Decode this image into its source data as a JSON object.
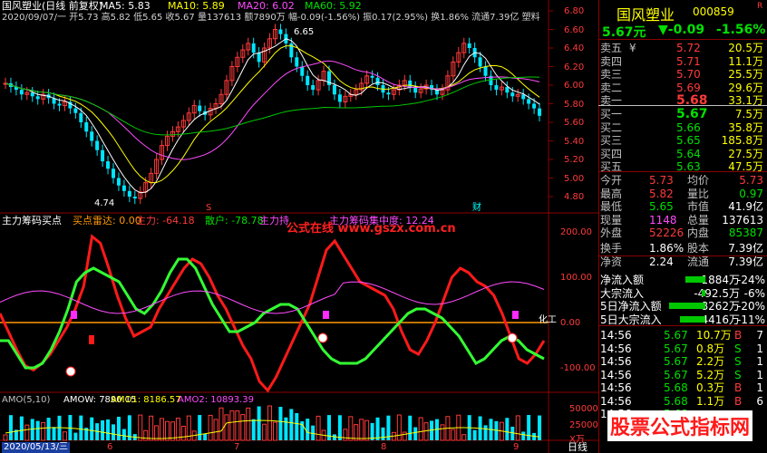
{
  "main_chart": {
    "title": "国风塑业(日线 前复权)",
    "ma5": "MA5: 5.83",
    "ma10": "MA10: 5.89",
    "ma20": "MA20: 6.02",
    "ma60": "MA60: 5.92",
    "ohlc_line": "2020/09/07/一 开5.73 高5.82 低5.65 收5.67 量137613 额7890万 幅-0.09(-1.56%) 振0.17(2.95%) 换1.86% 流通7.39亿 塑料",
    "high_mark": "6.65",
    "low_mark": "4.74",
    "price_axis": [
      "6.80",
      "6.60",
      "6.40",
      "6.20",
      "6.00",
      "5.80",
      "5.60",
      "5.40",
      "5.20",
      "5.00",
      "4.80"
    ],
    "marker_s": "S",
    "marker_cai": "财"
  },
  "indicator_chart": {
    "title": "主力筹码买点",
    "buy_radar": "买点雷达: 0.00",
    "main_force": "主力: -64.18",
    "retail": "散户: -78.78",
    "main_hold": "主力持",
    "concentration": "主力筹码集中度: 12.24",
    "sector_label": "化工",
    "axis": [
      "200.00",
      "100.00",
      "0.00",
      "-100.00"
    ],
    "watermark": "公式在线 www.gszx.com.cn"
  },
  "volume_chart": {
    "title": "AMO(5,10)",
    "amow": "AMOW: 7890.15",
    "amo1": "AMO1: 8186.57",
    "amo2": "AMO2: 10893.39",
    "axis": [
      "50000",
      "25000",
      "X万"
    ],
    "date_label": "2020/05/13/三",
    "month_labels": [
      "6",
      "7",
      "8",
      "9"
    ],
    "tab_label": "日线",
    "watermark": "股票公式指标网"
  },
  "quote_panel": {
    "stock_name": "国风塑业",
    "stock_code": "000859",
    "r_badge": "R",
    "price": "5.67元",
    "change": "▼-0.09",
    "change_pct": "-1.56%",
    "asks": [
      {
        "label": "卖五",
        "mark": "¥",
        "price": "5.72",
        "vol": "20.5万"
      },
      {
        "label": "卖四",
        "mark": "",
        "price": "5.71",
        "vol": "11.1万"
      },
      {
        "label": "卖三",
        "mark": "",
        "price": "5.70",
        "vol": "25.5万"
      },
      {
        "label": "卖二",
        "mark": "",
        "price": "5.69",
        "vol": "29.6万"
      },
      {
        "label": "卖一",
        "mark": "",
        "price": "5.68",
        "vol": "33.1万"
      }
    ],
    "bids": [
      {
        "label": "买一",
        "price": "5.67",
        "vol": "7.5万"
      },
      {
        "label": "买二",
        "price": "5.66",
        "vol": "35.8万"
      },
      {
        "label": "买三",
        "price": "5.65",
        "vol": "185.8万"
      },
      {
        "label": "买四",
        "price": "5.64",
        "vol": "27.5万"
      },
      {
        "label": "买五",
        "price": "5.63",
        "vol": "47.5万"
      }
    ],
    "stats": [
      {
        "l1": "今开",
        "v1": "5.73",
        "c1": "red",
        "l2": "均价",
        "v2": "5.73",
        "c2": "red"
      },
      {
        "l1": "最高",
        "v1": "5.82",
        "c1": "red",
        "l2": "量比",
        "v2": "0.97",
        "c2": "green"
      },
      {
        "l1": "最低",
        "v1": "5.65",
        "c1": "green",
        "l2": "市值",
        "v2": "41.9亿",
        "c2": "white"
      },
      {
        "l1": "现量",
        "v1": "1148",
        "c1": "mag",
        "l2": "总量",
        "v2": "137613",
        "c2": "white"
      },
      {
        "l1": "外盘",
        "v1": "52226",
        "c1": "red",
        "l2": "内盘",
        "v2": "85387",
        "c2": "green"
      }
    ],
    "stats2": [
      {
        "l1": "换手",
        "v1": "1.86%",
        "l2": "股本",
        "v2": "7.39亿"
      },
      {
        "l1": "净资",
        "v1": "2.24",
        "l2": "流通",
        "v2": "7.39亿"
      }
    ],
    "flows": [
      {
        "label": "净流入额",
        "val": "-1884万",
        "pct": "-24%",
        "bar": 22
      },
      {
        "label": "大宗流入",
        "val": "-492.5万",
        "pct": "-6%",
        "bar": 4
      },
      {
        "label": "5日净流入额",
        "val": "-8262万",
        "pct": "-20%",
        "bar": 40
      },
      {
        "label": "5日大宗流入",
        "val": "-4416万",
        "pct": "-11%",
        "bar": 28
      }
    ],
    "ticks": [
      {
        "time": "14:56",
        "price": "5.67",
        "vol": "10.7万",
        "side": "B",
        "n": "7"
      },
      {
        "time": "14:56",
        "price": "5.67",
        "vol": "0.8万",
        "side": "S",
        "n": "1"
      },
      {
        "time": "14:56",
        "price": "5.67",
        "vol": "2.2万",
        "side": "S",
        "n": "1"
      },
      {
        "time": "14:56",
        "price": "5.67",
        "vol": "5.2万",
        "side": "S",
        "n": "1"
      },
      {
        "time": "14:56",
        "price": "5.68",
        "vol": "0.3万",
        "side": "B",
        "n": "1"
      },
      {
        "time": "14:56",
        "price": "5.68",
        "vol": "1.1万",
        "side": "B",
        "n": "6"
      },
      {
        "time": "14:56",
        "price": "5.68",
        "vol": "",
        "side": "",
        "n": ""
      }
    ]
  }
}
